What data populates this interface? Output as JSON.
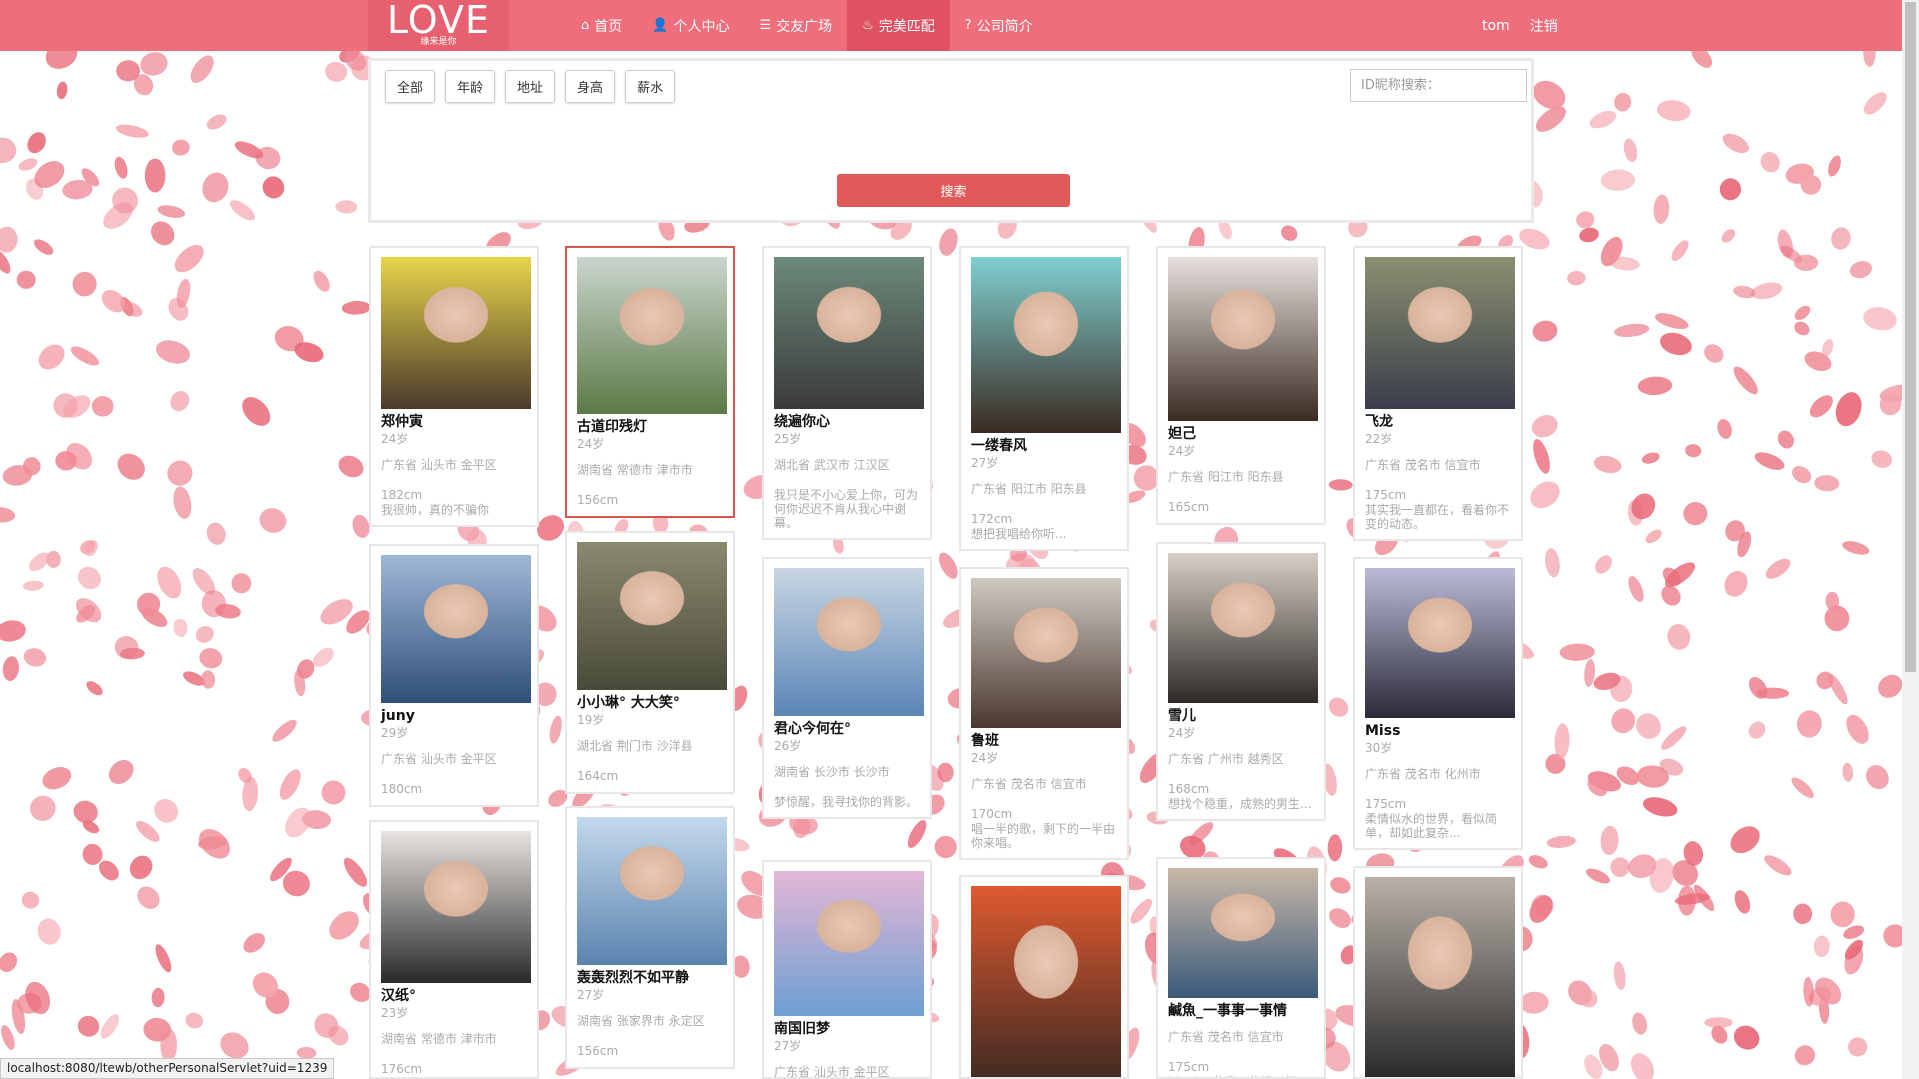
{
  "nav": {
    "logo": "LOVE",
    "logo_sub": "缘来是你",
    "items": [
      {
        "icon": "home-icon",
        "glyph": "⌂",
        "label": "首页"
      },
      {
        "icon": "user-icon",
        "glyph": "👤",
        "label": "个人中心"
      },
      {
        "icon": "list-icon",
        "glyph": "☰",
        "label": "交友广场"
      },
      {
        "icon": "fire-icon",
        "glyph": "♨",
        "label": "完美匹配"
      },
      {
        "icon": "question-icon",
        "glyph": "?",
        "label": "公司简介"
      }
    ],
    "user": "tom",
    "logout": "注销"
  },
  "filter": {
    "buttons": [
      "全部",
      "年龄",
      "地址",
      "身高",
      "薪水"
    ],
    "search_placeholder": "ID昵称搜索：",
    "search_button": "搜索"
  },
  "cards": [
    {
      "name": "郑仲寅",
      "age": "24岁",
      "location": "广东省 汕头市 金平区",
      "height": "182cm",
      "bio": "我很帅，真的不骗你"
    },
    {
      "name": "古道印残灯",
      "age": "24岁",
      "location": "湖南省 常德市 津市市",
      "height": "156cm",
      "bio": ""
    },
    {
      "name": "绕遍你心",
      "age": "25岁",
      "location": "湖北省 武汉市 江汉区",
      "height": "",
      "bio": "我只是不小心爱上你，可为何你迟迟不肯从我心中谢幕。"
    },
    {
      "name": "一缕春风",
      "age": "27岁",
      "location": "广东省 阳江市 阳东县",
      "height": "172cm",
      "bio": "想把我唱给你听..."
    },
    {
      "name": "妲己",
      "age": "24岁",
      "location": "广东省 阳江市 阳东县",
      "height": "165cm",
      "bio": ""
    },
    {
      "name": "飞龙",
      "age": "22岁",
      "location": "广东省 茂名市 信宜市",
      "height": "175cm",
      "bio": "其实我一直都在，看着你不变的动态。"
    },
    {
      "name": "juny",
      "age": "29岁",
      "location": "广东省 汕头市 金平区",
      "height": "180cm",
      "bio": ""
    },
    {
      "name": "小小琳° 大大笑°",
      "age": "19岁",
      "location": "湖北省 荆门市 沙洋县",
      "height": "164cm",
      "bio": ""
    },
    {
      "name": "君心今何在°",
      "age": "26岁",
      "location": "湖南省 长沙市 长沙市",
      "height": "",
      "bio": "梦惊醒，我寻找你的背影。"
    },
    {
      "name": "鲁班",
      "age": "24岁",
      "location": "广东省 茂名市 信宜市",
      "height": "170cm",
      "bio": "唱一半的歌，剩下的一半由你来唱。"
    },
    {
      "name": "雪儿",
      "age": "24岁",
      "location": "广东省 广州市 越秀区",
      "height": "168cm",
      "bio": "想找个稳重，成熟的男生..."
    },
    {
      "name": "Miss",
      "age": "30岁",
      "location": "广东省 茂名市 化州市",
      "height": "175cm",
      "bio": "柔情似水的世界，看似简单，却如此复杂..."
    },
    {
      "name": "汉纸°",
      "age": "23岁",
      "location": "湖南省 常德市 津市市",
      "height": "176cm",
      "bio": ""
    },
    {
      "name": "轰轰烈烈不如平静",
      "age": "27岁",
      "location": "湖南省 张家界市 永定区",
      "height": "156cm",
      "bio": ""
    },
    {
      "name": "南国旧梦",
      "age": "27岁",
      "location": "广东省 汕头市 金平区",
      "height": "",
      "bio": ""
    },
    {
      "name": "",
      "age": "",
      "location": "",
      "height": "",
      "bio": ""
    },
    {
      "name": "鹹魚_一事事一事情",
      "age": "",
      "location": "广东省 茂名市 信宜市",
      "height": "175cm",
      "bio": "ideal 一些事一些情，继"
    },
    {
      "name": "",
      "age": "",
      "location": "",
      "height": "",
      "bio": ""
    }
  ],
  "status_url": "localhost:8080/ltewb/otherPersonalServlet?uid=1239",
  "colors": {
    "nav": "#ee6e7c",
    "active": "#e05262",
    "search_button": "#e05a5a",
    "petal": "#ee8a95"
  }
}
